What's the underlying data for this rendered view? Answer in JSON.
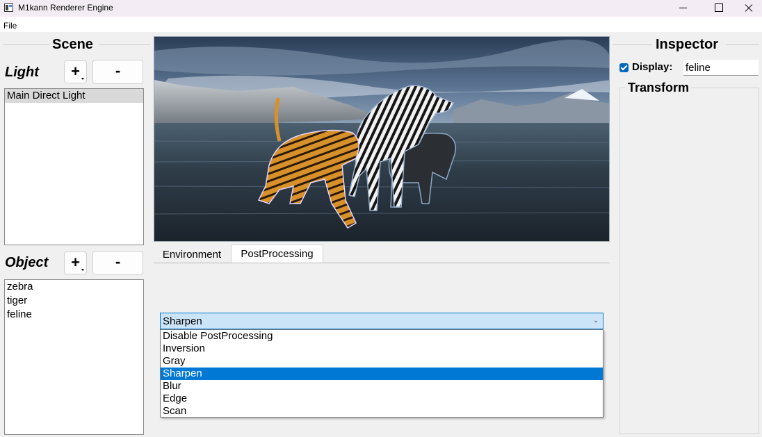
{
  "window": {
    "title": "M1kann Renderer Engine"
  },
  "menu": {
    "file": "File"
  },
  "scene": {
    "title": "Scene",
    "light": {
      "label": "Light",
      "add_label": "+",
      "remove_label": "-",
      "items": [
        "Main Direct Light"
      ],
      "selected_index": 0
    },
    "object": {
      "label": "Object",
      "add_label": "+",
      "remove_label": "-",
      "items": [
        "zebra",
        "tiger",
        "feline"
      ]
    }
  },
  "tabs": {
    "environment": "Environment",
    "postprocessing": "PostProcessing",
    "active": "PostProcessing"
  },
  "postprocessing": {
    "selected": "Sharpen",
    "options": [
      "Disable PostProcessing",
      "Inversion",
      "Gray",
      "Sharpen",
      "Blur",
      "Edge",
      "Scan"
    ],
    "selected_index": 3
  },
  "inspector": {
    "title": "Inspector",
    "display_label": "Display:",
    "display_checked": true,
    "display_value": "feline",
    "transform_title": "Transform"
  },
  "colors": {
    "accent": "#0078d4",
    "selection_gray": "#d9d9d9"
  },
  "icons": {
    "app": "app-icon",
    "minimize": "minimize-icon",
    "maximize": "maximize-icon",
    "close": "close-icon",
    "dropdown": "chevron-down-icon"
  }
}
